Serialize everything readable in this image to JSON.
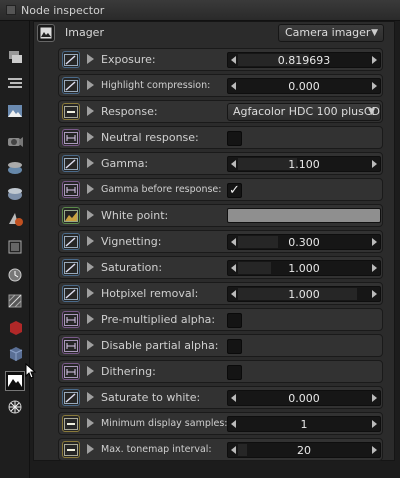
{
  "window": {
    "title": "Node inspector"
  },
  "toolbar": {
    "icons": [
      "layers-icon",
      "stack-icon",
      "image-icon",
      "camera-icon",
      "environment-icon",
      "geometry-icon",
      "material-icon",
      "texture-icon",
      "emission-icon",
      "medium-icon",
      "transform-icon",
      "object-layer-icon",
      "render-target-icon",
      "imager-icon",
      "postprocess-icon"
    ]
  },
  "node": {
    "title": "Imager",
    "type_value": "Camera imager"
  },
  "params": [
    {
      "label": "Exposure:",
      "kind": "slider",
      "value": "0.819693",
      "fill": 0.54,
      "icon": "curve-icon",
      "color": "blue"
    },
    {
      "label": "Highlight compression:",
      "kind": "slider",
      "value": "0.000",
      "fill": 0.0,
      "icon": "curve-icon",
      "color": "blue",
      "small": true
    },
    {
      "label": "Response:",
      "kind": "combo",
      "value": "Agfacolor HDC 100 plusCD",
      "icon": "enum-icon",
      "color": "gold"
    },
    {
      "label": "Neutral response:",
      "kind": "check",
      "value": "",
      "icon": "bool-icon",
      "color": "purple"
    },
    {
      "label": "Gamma:",
      "kind": "slider",
      "value": "1.100",
      "fill": 0.45,
      "icon": "curve-icon",
      "color": "blue"
    },
    {
      "label": "Gamma before response:",
      "kind": "check",
      "value": "✓",
      "icon": "bool-icon",
      "color": "purple",
      "small": true
    },
    {
      "label": "White point:",
      "kind": "swatch",
      "value": "",
      "icon": "rgb-icon",
      "color": "green"
    },
    {
      "label": "Vignetting:",
      "kind": "slider",
      "value": "0.300",
      "fill": 0.3,
      "icon": "curve-icon",
      "color": "blue"
    },
    {
      "label": "Saturation:",
      "kind": "slider",
      "value": "1.000",
      "fill": 0.25,
      "icon": "curve-icon",
      "color": "blue"
    },
    {
      "label": "Hotpixel removal:",
      "kind": "slider",
      "value": "1.000",
      "fill": 0.9,
      "icon": "curve-icon",
      "color": "blue"
    },
    {
      "label": "Pre-multiplied alpha:",
      "kind": "check",
      "value": "",
      "icon": "bool-icon",
      "color": "purple"
    },
    {
      "label": "Disable partial alpha:",
      "kind": "check",
      "value": "",
      "icon": "bool-icon",
      "color": "purple"
    },
    {
      "label": "Dithering:",
      "kind": "check",
      "value": "",
      "icon": "bool-icon",
      "color": "purple"
    },
    {
      "label": "Saturate to white:",
      "kind": "slider",
      "value": "0.000",
      "fill": 0.0,
      "icon": "curve-icon",
      "color": "blue"
    },
    {
      "label": "Minimum display samples:",
      "kind": "slider",
      "value": "1",
      "fill": 0.0,
      "icon": "int-icon",
      "color": "gold",
      "small": true
    },
    {
      "label": "Max. tonemap interval:",
      "kind": "slider",
      "value": "20",
      "fill": 0.07,
      "icon": "int-icon",
      "color": "gold",
      "small": true
    }
  ]
}
